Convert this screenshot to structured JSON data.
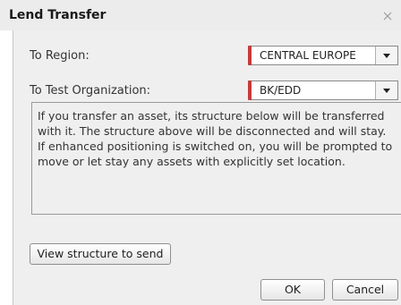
{
  "dialog": {
    "title": "Lend Transfer",
    "close_icon": "close-icon"
  },
  "form": {
    "region_label": "To Region:",
    "region_value": "CENTRAL EUROPE",
    "org_label": "To Test Organization:",
    "org_value": "BK/EDD"
  },
  "info": {
    "text": "If you transfer an asset, its structure below will be transferred with it. The structure above will be disconnected and will stay. If enhanced positioning is switched on, you will be prompted to move or let stay any assets with explicitly set location."
  },
  "buttons": {
    "view_structure": "View structure to send",
    "ok": "OK",
    "cancel": "Cancel"
  },
  "colors": {
    "accent": "#c53b3b",
    "panel": "#efefef"
  }
}
